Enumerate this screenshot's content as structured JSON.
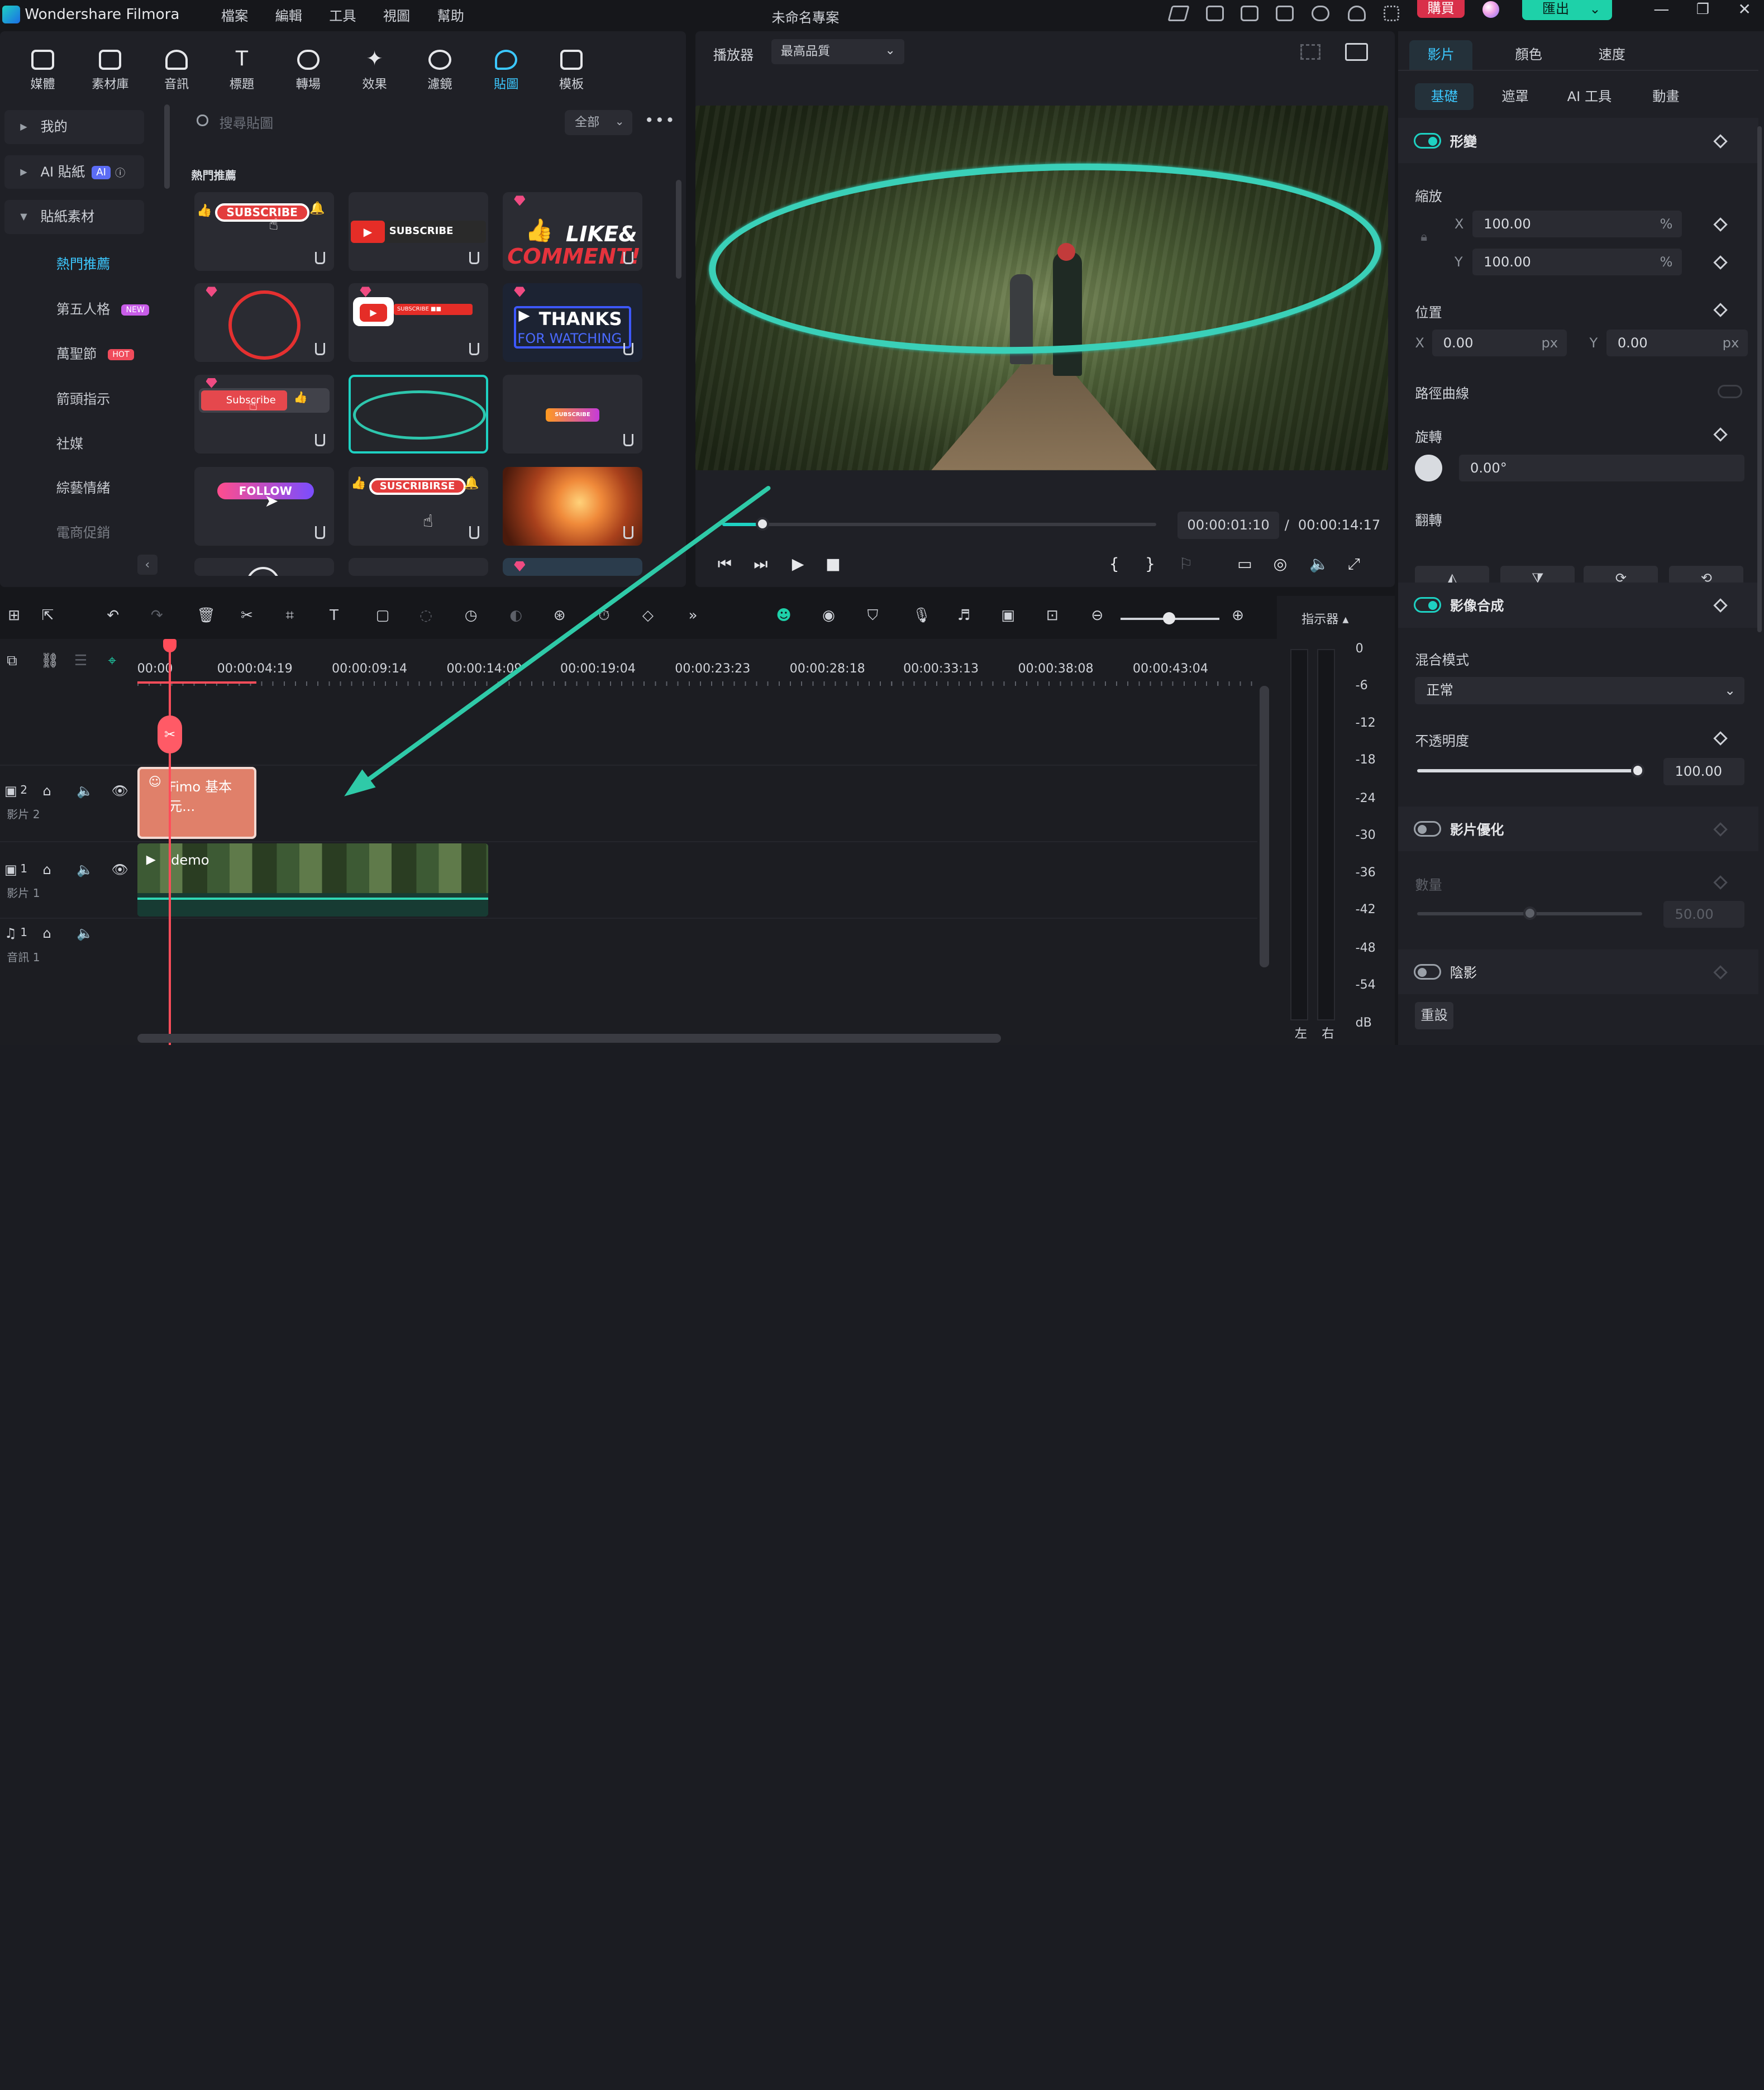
{
  "titlebar": {
    "app": "Wondershare Filmora",
    "menu": [
      "檔案",
      "編輯",
      "工具",
      "視圖",
      "幫助"
    ],
    "project": "未命名專案",
    "buy": "購買",
    "export": "匯出"
  },
  "toolbar": [
    {
      "label": "媒體",
      "icon": "media-icon"
    },
    {
      "label": "素材庫",
      "icon": "library-icon"
    },
    {
      "label": "音訊",
      "icon": "music-icon"
    },
    {
      "label": "標題",
      "icon": "title-icon"
    },
    {
      "label": "轉場",
      "icon": "transition-icon"
    },
    {
      "label": "效果",
      "icon": "effects-icon"
    },
    {
      "label": "濾鏡",
      "icon": "filter-icon"
    },
    {
      "label": "貼圖",
      "icon": "sticker-icon",
      "active": true
    },
    {
      "label": "模板",
      "icon": "template-icon"
    }
  ],
  "sidebar": {
    "items": [
      "我的",
      "AI 貼紙",
      "貼紙素材"
    ],
    "ai_badge": "AI",
    "sub": [
      "熱門推薦",
      "第五人格",
      "萬聖節",
      "箭頭指示",
      "社媒",
      "綜藝情緒",
      "電商促銷"
    ],
    "new_badge": "NEW",
    "hot_badge": "HOT"
  },
  "search": {
    "placeholder": "搜尋貼圖",
    "filter": "全部"
  },
  "section_title": "熱門推薦",
  "stickers": {
    "subscribe": "SUBSCRIBE",
    "subscribe2": "SUBSCRIBE",
    "like": "LIKE&",
    "comment": "COMMENT!",
    "thanks": "THANKS",
    "watching": "FOR WATCHING",
    "sub3": "Subscribe",
    "follow": "FOLLOW",
    "suscribirse": "SUSCRIBIRSE",
    "tiny": "SUBSCRIBE"
  },
  "player": {
    "label": "播放器",
    "quality": "最高品質",
    "current": "00:00:01:10",
    "sep": "/",
    "total": "00:00:14:17"
  },
  "right": {
    "tabs": [
      "影片",
      "顏色",
      "速度"
    ],
    "subtabs": [
      "基礎",
      "遮罩",
      "AI 工具",
      "動畫"
    ],
    "transform": "形變",
    "scale": "縮放",
    "x_label": "X",
    "y_label": "Y",
    "scale_x": "100.00",
    "scale_y": "100.00",
    "pct": "%",
    "position": "位置",
    "pos_x": "0.00",
    "pos_y": "0.00",
    "px": "px",
    "path": "路徑曲線",
    "rotate": "旋轉",
    "rot_val": "0.00°",
    "flip": "翻轉",
    "composite": "影像合成",
    "blend": "混合模式",
    "blend_val": "正常",
    "opacity": "不透明度",
    "opacity_val": "100.00",
    "enhance": "影片優化",
    "amount": "數量",
    "amount_val": "50.00",
    "shadow": "陰影",
    "reset": "重設"
  },
  "timeline": {
    "ticks": [
      "00:00",
      "00:00:04:19",
      "00:00:09:14",
      "00:00:14:09",
      "00:00:19:04",
      "00:00:23:23",
      "00:00:28:18",
      "00:00:33:13",
      "00:00:38:08",
      "00:00:43:04"
    ],
    "tracks": [
      {
        "num": "2",
        "name": "影片 2"
      },
      {
        "num": "1",
        "name": "影片 1"
      },
      {
        "num": "1",
        "name": "音訊 1"
      }
    ],
    "clip_sticker": "Fimo 基本元...",
    "clip_video": "demo",
    "indicator": "指示器"
  },
  "meter": {
    "levels": [
      "0",
      "-6",
      "-12",
      "-18",
      "-24",
      "-30",
      "-36",
      "-42",
      "-48",
      "-54",
      "dB"
    ],
    "left": "左",
    "right": "右"
  },
  "colors": {
    "accent": "#1ed1c2",
    "blue": "#3cc8ff",
    "playhead": "#ff4d5a",
    "buy": "#d9304a"
  }
}
